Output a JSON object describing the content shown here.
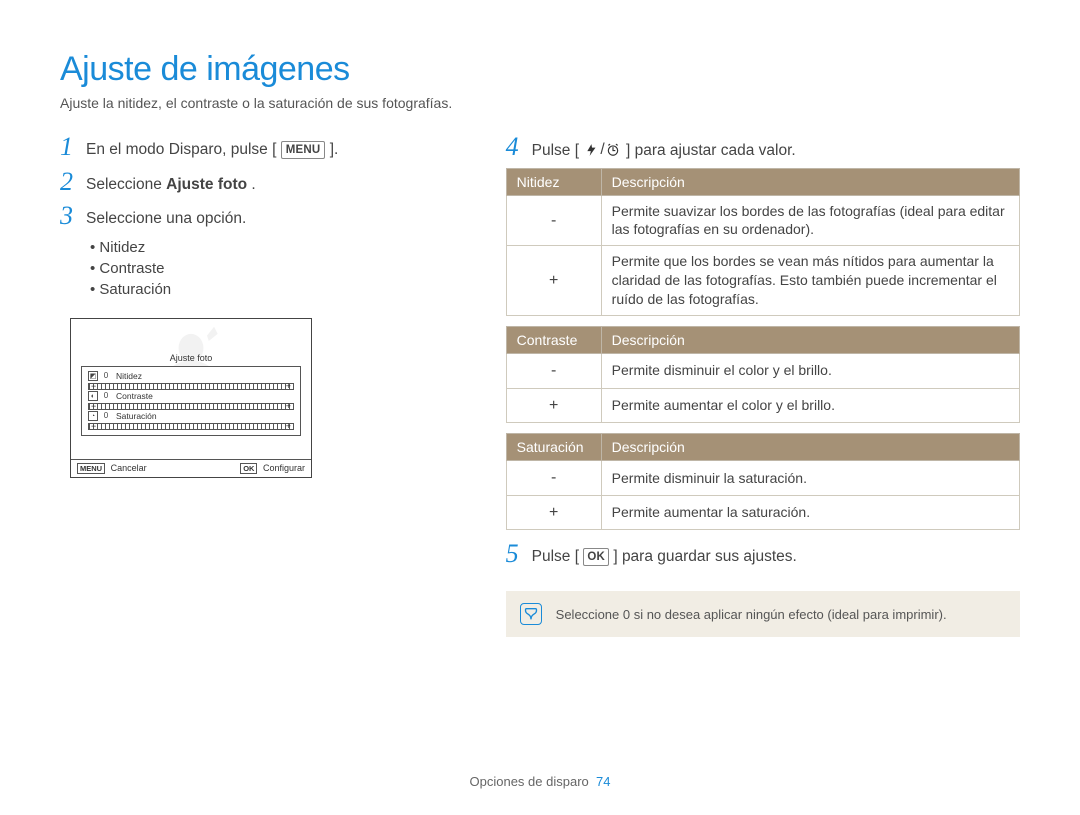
{
  "title": "Ajuste de imágenes",
  "subtitle": "Ajuste la nitidez, el contraste o la saturación de sus fotografías.",
  "steps": {
    "s1_a": "En el modo Disparo, pulse [",
    "s1_key": "MENU",
    "s1_b": "].",
    "s2_a": "Seleccione ",
    "s2_bold": "Ajuste foto",
    "s2_b": ".",
    "s3": "Seleccione una opción.",
    "s4_a": "Pulse [",
    "s4_b": "] para ajustar cada valor.",
    "s5_a": "Pulse [",
    "s5_key": "OK",
    "s5_b": "] para guardar sus ajustes."
  },
  "bullets": [
    "Nitidez",
    "Contraste",
    "Saturación"
  ],
  "camshot": {
    "menu_label": "Ajuste foto",
    "rows": [
      {
        "label": "Nitidez",
        "value": "0"
      },
      {
        "label": "Contraste",
        "value": "0"
      },
      {
        "label": "Saturación",
        "value": "0"
      }
    ],
    "cancel_key": "MENU",
    "cancel_label": "Cancelar",
    "ok_key": "OK",
    "ok_label": "Configurar"
  },
  "tables": {
    "nitidez": {
      "h1": "Nitidez",
      "h2": "Descripción",
      "rows": [
        {
          "sym": "-",
          "txt": "Permite suavizar los bordes de las fotografías (ideal para editar las fotografías en su ordenador)."
        },
        {
          "sym": "+",
          "txt": "Permite que los bordes se vean más nítidos para aumentar la claridad de las fotografías. Esto también puede incrementar el ruído de las fotografías."
        }
      ]
    },
    "contraste": {
      "h1": "Contraste",
      "h2": "Descripción",
      "rows": [
        {
          "sym": "-",
          "txt": "Permite disminuir el color y el brillo."
        },
        {
          "sym": "+",
          "txt": "Permite aumentar el color y el brillo."
        }
      ]
    },
    "saturacion": {
      "h1": "Saturación",
      "h2": "Descripción",
      "rows": [
        {
          "sym": "-",
          "txt": "Permite disminuir la saturación."
        },
        {
          "sym": "+",
          "txt": "Permite aumentar la saturación."
        }
      ]
    }
  },
  "note": "Seleccione 0 si no desea aplicar ningún efecto (ideal para imprimir).",
  "footer_section": "Opciones de disparo",
  "footer_page": "74"
}
